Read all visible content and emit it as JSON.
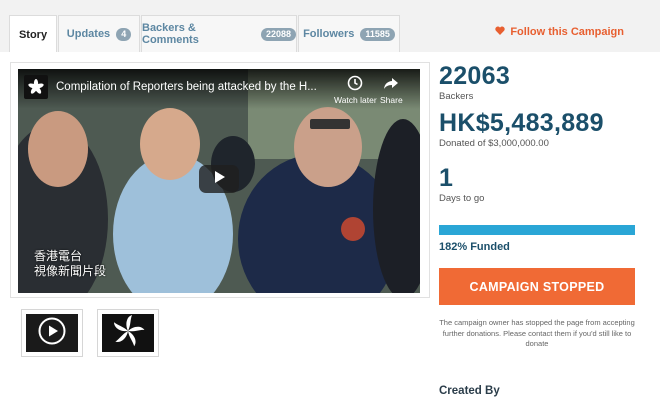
{
  "tabs": [
    {
      "label": "Story",
      "count": null
    },
    {
      "label": "Updates",
      "count": "4"
    },
    {
      "label": "Backers & Comments",
      "count": "22088"
    },
    {
      "label": "Followers",
      "count": "11585"
    }
  ],
  "follow": {
    "label": "Follow this Campaign",
    "icon": "heart-icon"
  },
  "video": {
    "title": "Compilation of Reporters being attacked by the H...",
    "watch_later": "Watch later",
    "share": "Share",
    "caption_line1": "香港電台",
    "caption_line2": "視像新聞片段"
  },
  "stats": {
    "backers_count": "22063",
    "backers_label": "Backers",
    "donated_amount": "HK$5,483,889",
    "donated_label": "Donated of $3,000,000.00",
    "days_count": "1",
    "days_label": "Days to go",
    "funded_percent": 182,
    "funded_label": "182% Funded"
  },
  "cta": {
    "label": "CAMPAIGN STOPPED"
  },
  "notice": "The campaign owner has stopped the page from accepting further donations. Please contact them if you'd still like to donate",
  "created_by_label": "Created By",
  "colors": {
    "accent": "#f06a35",
    "progress": "#2aa6d6",
    "heading": "#1b4f6a"
  }
}
